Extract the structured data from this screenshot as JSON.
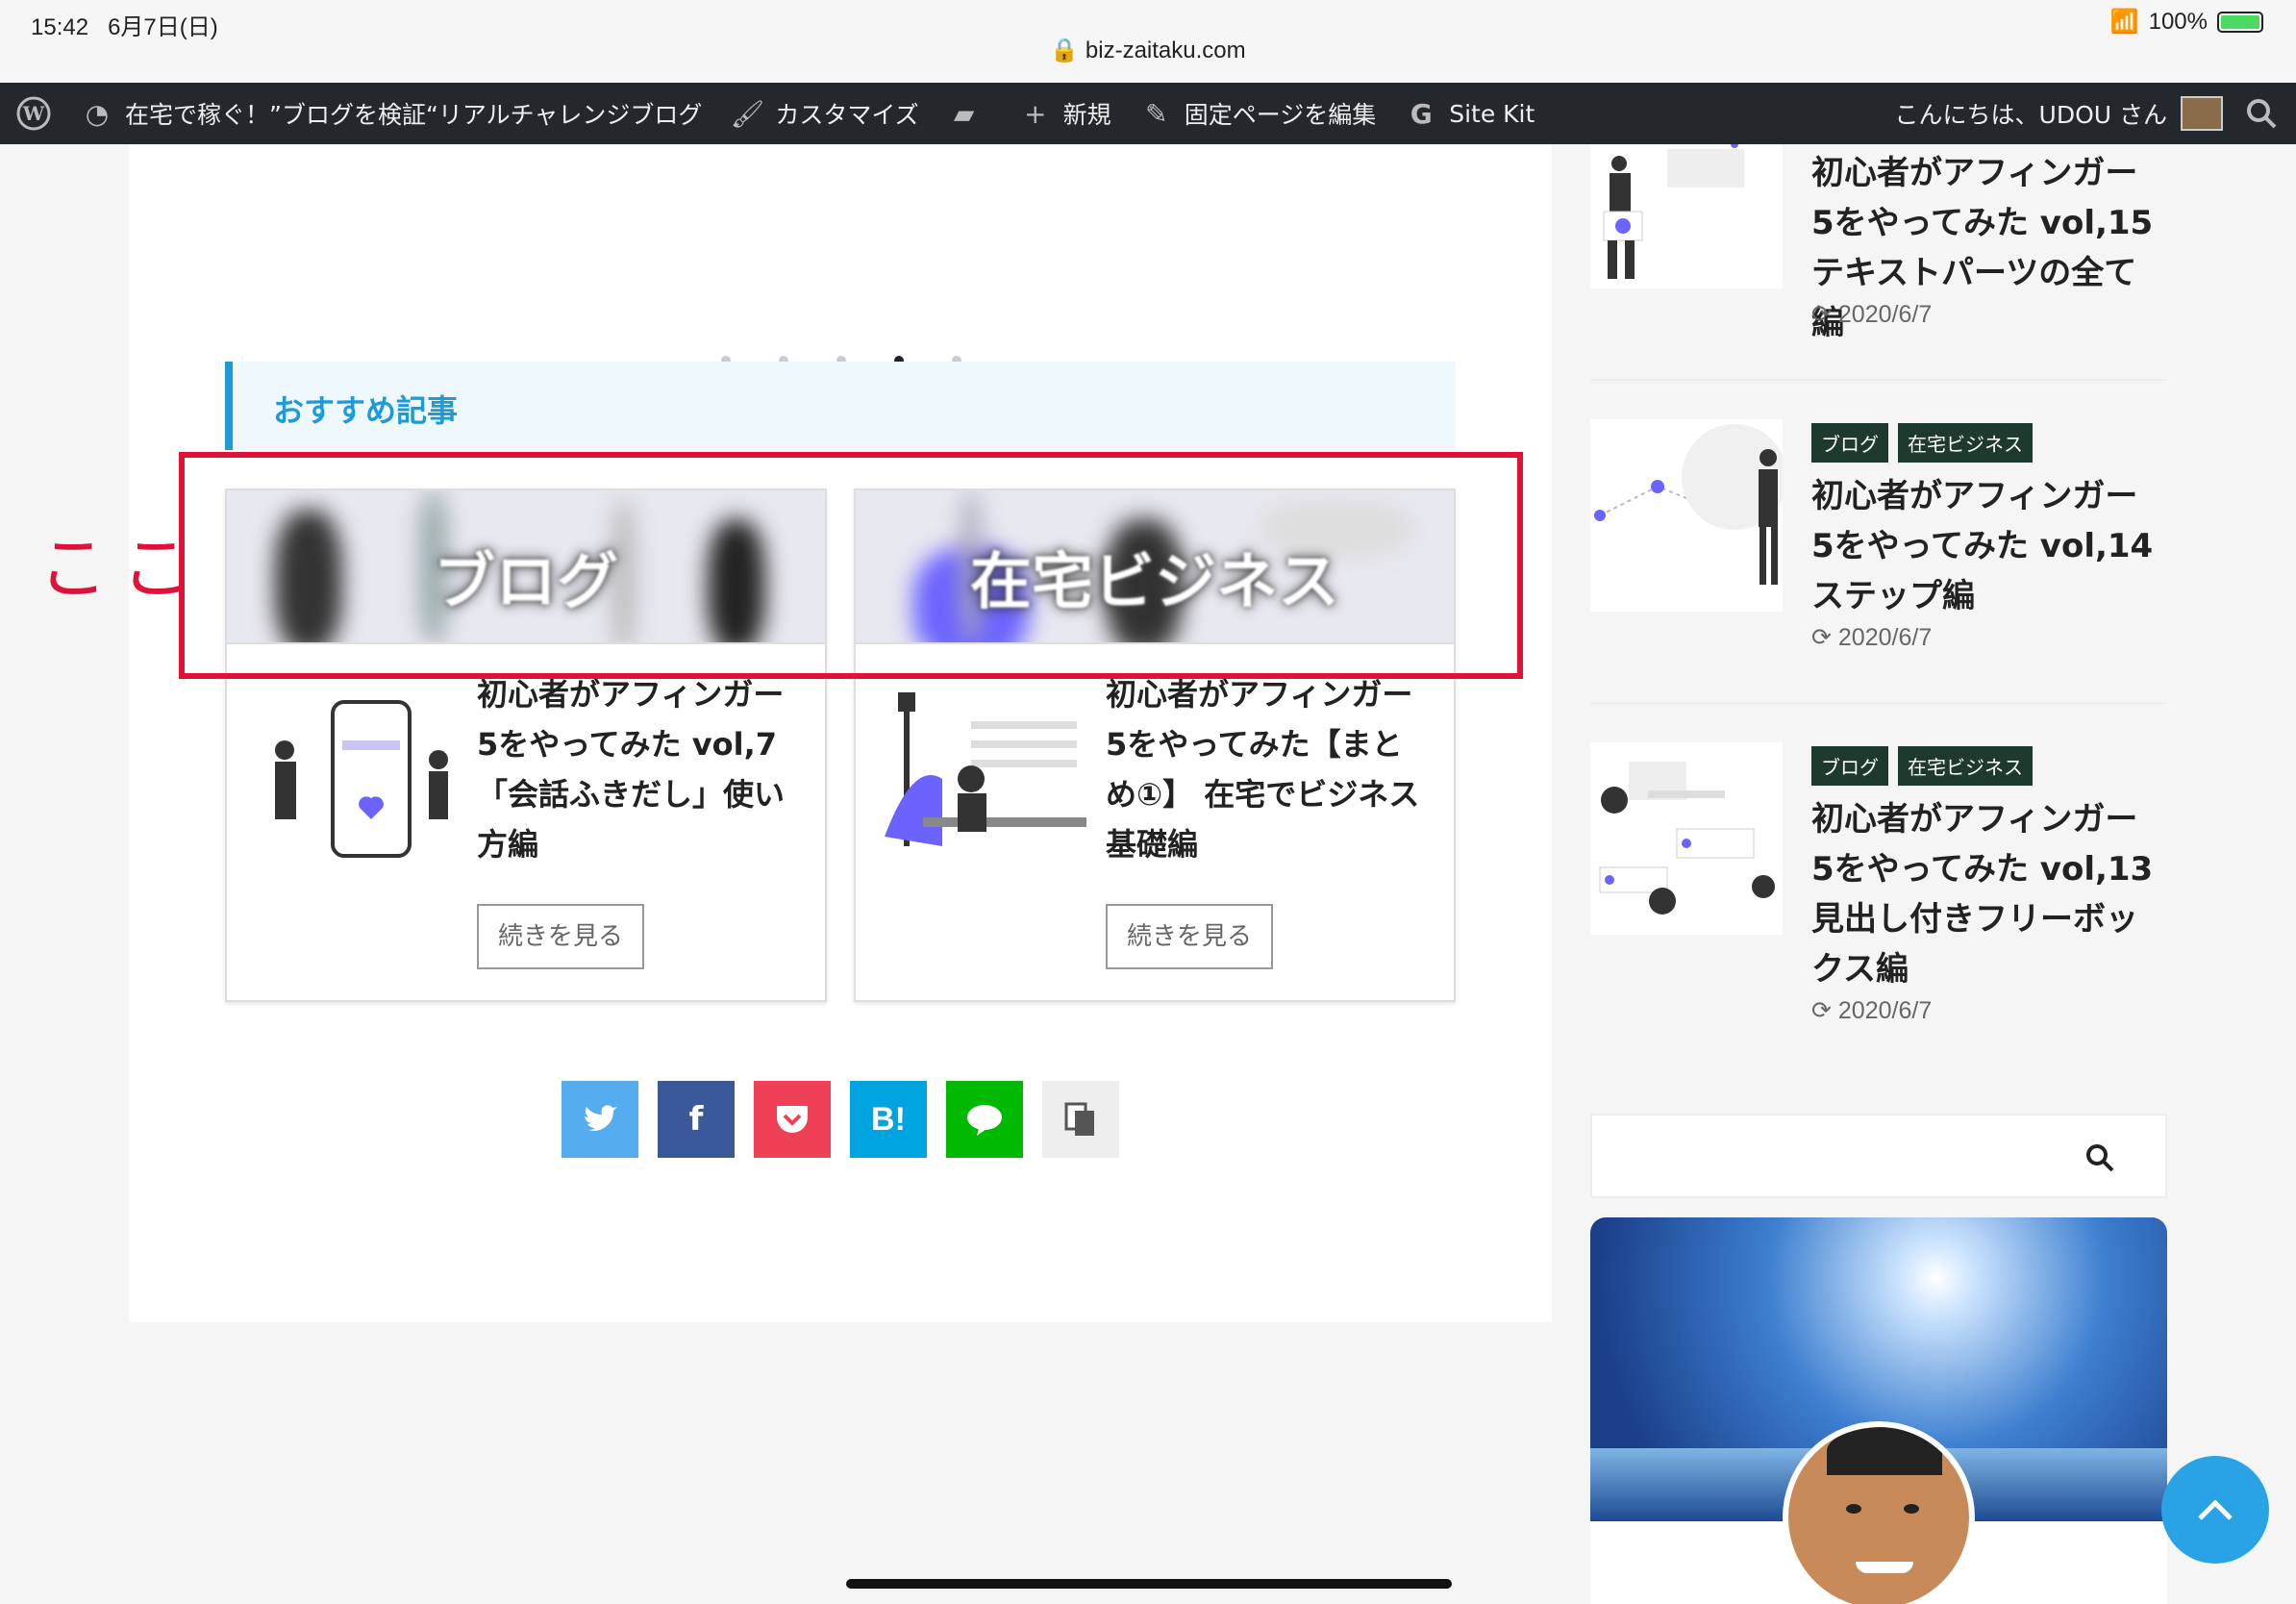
{
  "status": {
    "time": "15:42",
    "date": "6月7日(日)",
    "url": "biz-zaitaku.com",
    "battery": "100%"
  },
  "adminbar": {
    "site_title": "在宅で稼ぐ！”ブログを検証“リアルチャレンジブログ",
    "customize": "カスタマイズ",
    "new": "新規",
    "edit_page": "固定ページを編集",
    "sitekit": "Site Kit",
    "greeting": "こんにちは、UDOU さん"
  },
  "slider": {
    "dot_count": 5,
    "active_index": 3
  },
  "recommend": {
    "heading": "おすすめ記事",
    "cards": [
      {
        "banner": "ブログ",
        "title": "初心者がアフィンガー5をやってみた vol,7 「会話ふきだし」使い方編",
        "more": "続きを見る"
      },
      {
        "banner": "在宅ビジネス",
        "title": "初心者がアフィンガー5をやってみた【まとめ①】 在宅でビジネス基礎編",
        "more": "続きを見る"
      }
    ]
  },
  "annotation": {
    "label": "ここ",
    "color": "#e0123a"
  },
  "share": [
    {
      "name": "twitter",
      "glyph": "🐦",
      "color": "#55acee"
    },
    {
      "name": "facebook",
      "glyph": "f",
      "color": "#3b5998"
    },
    {
      "name": "pocket",
      "glyph": "⌄",
      "color": "#ef4056"
    },
    {
      "name": "hatena",
      "glyph": "B!",
      "color": "#00a4de"
    },
    {
      "name": "line",
      "glyph": "💬",
      "color": "#00b900"
    },
    {
      "name": "copy",
      "glyph": "📋",
      "color": "#eeeeee"
    }
  ],
  "sidebar": {
    "items": [
      {
        "title": "初心者がアフィンガー5をやってみた vol,15 テキストパーツの全て編",
        "date": "2020/6/7",
        "tags": []
      },
      {
        "title": "初心者がアフィンガー5をやってみた vol,14 ステップ編",
        "date": "2020/6/7",
        "tags": [
          "ブログ",
          "在宅ビジネス"
        ]
      },
      {
        "title": "初心者がアフィンガー5をやってみた vol,13 見出し付きフリーボックス編",
        "date": "2020/6/7",
        "tags": [
          "ブログ",
          "在宅ビジネス"
        ]
      }
    ]
  },
  "colors": {
    "accent": "#1e9bd7",
    "adminbar": "#23282d",
    "tag_bg": "#1e3a2e"
  }
}
